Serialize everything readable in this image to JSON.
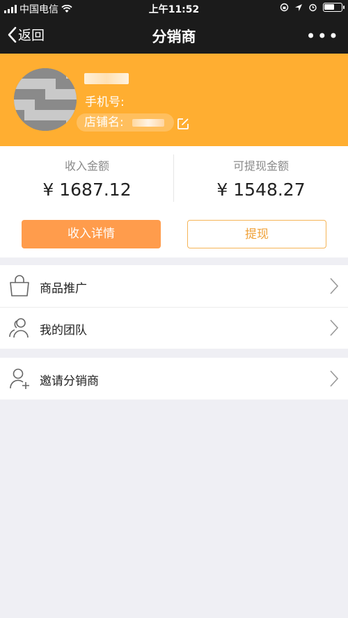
{
  "status_bar": {
    "carrier": "中国电信",
    "time": "上午11:52"
  },
  "nav": {
    "back_label": "返回",
    "title": "分销商",
    "more_label": "•••"
  },
  "profile": {
    "phone_label": "手机号:",
    "store_label": "店铺名:"
  },
  "earnings": {
    "income_label": "收入金额",
    "income_value": "¥ 1687.12",
    "withdrawable_label": "可提现金额",
    "withdrawable_value": "¥ 1548.27"
  },
  "actions": {
    "income_detail": "收入详情",
    "withdraw": "提现"
  },
  "menu": {
    "items": [
      {
        "label": "商品推广",
        "icon": "shopping-bag-icon"
      },
      {
        "label": "我的团队",
        "icon": "team-icon"
      },
      {
        "label": "邀请分销商",
        "icon": "add-user-icon"
      }
    ]
  },
  "colors": {
    "header_orange": "#ffae31",
    "button_orange": "#ff9c4c",
    "nav_dark": "#1b1b1b"
  }
}
